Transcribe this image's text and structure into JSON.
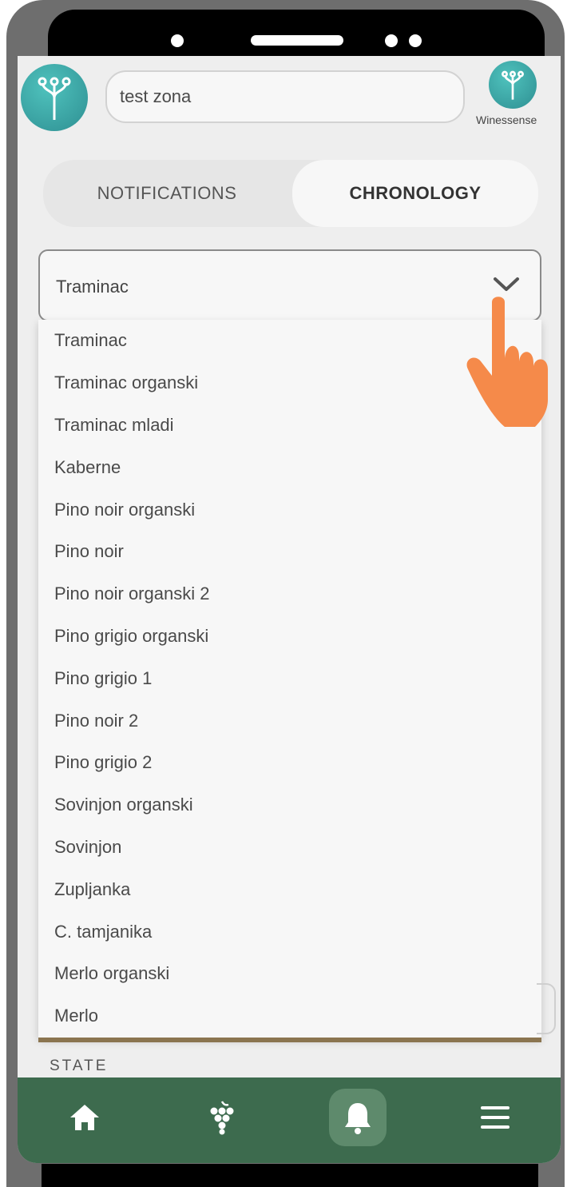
{
  "header": {
    "zone_value": "test zona",
    "brand_name": "Winessense"
  },
  "tabs": [
    {
      "label": "NOTIFICATIONS",
      "active": false
    },
    {
      "label": "CHRONOLOGY",
      "active": true
    }
  ],
  "select": {
    "selected": "Traminac",
    "options": [
      "Traminac",
      "Traminac organski",
      "Traminac mladi",
      "Kaberne",
      "Pino noir organski",
      "Pino noir",
      "Pino noir organski 2",
      "Pino grigio organski",
      "Pino grigio 1",
      "Pino noir 2",
      "Pino grigio 2",
      "Sovinjon organski",
      "Sovinjon",
      "Zupljanka",
      "C. tamjanika",
      "Merlo organski",
      "Merlo"
    ]
  },
  "section": {
    "state_label": "STATE"
  },
  "nav": {
    "items": [
      {
        "icon": "home-icon"
      },
      {
        "icon": "grapes-icon"
      },
      {
        "icon": "bell-icon",
        "active": true
      },
      {
        "icon": "menu-icon"
      }
    ]
  },
  "colors": {
    "accent_teal": "#3aa9a9",
    "nav_green": "#3d6b4e",
    "hand_orange": "#f58a4a"
  }
}
